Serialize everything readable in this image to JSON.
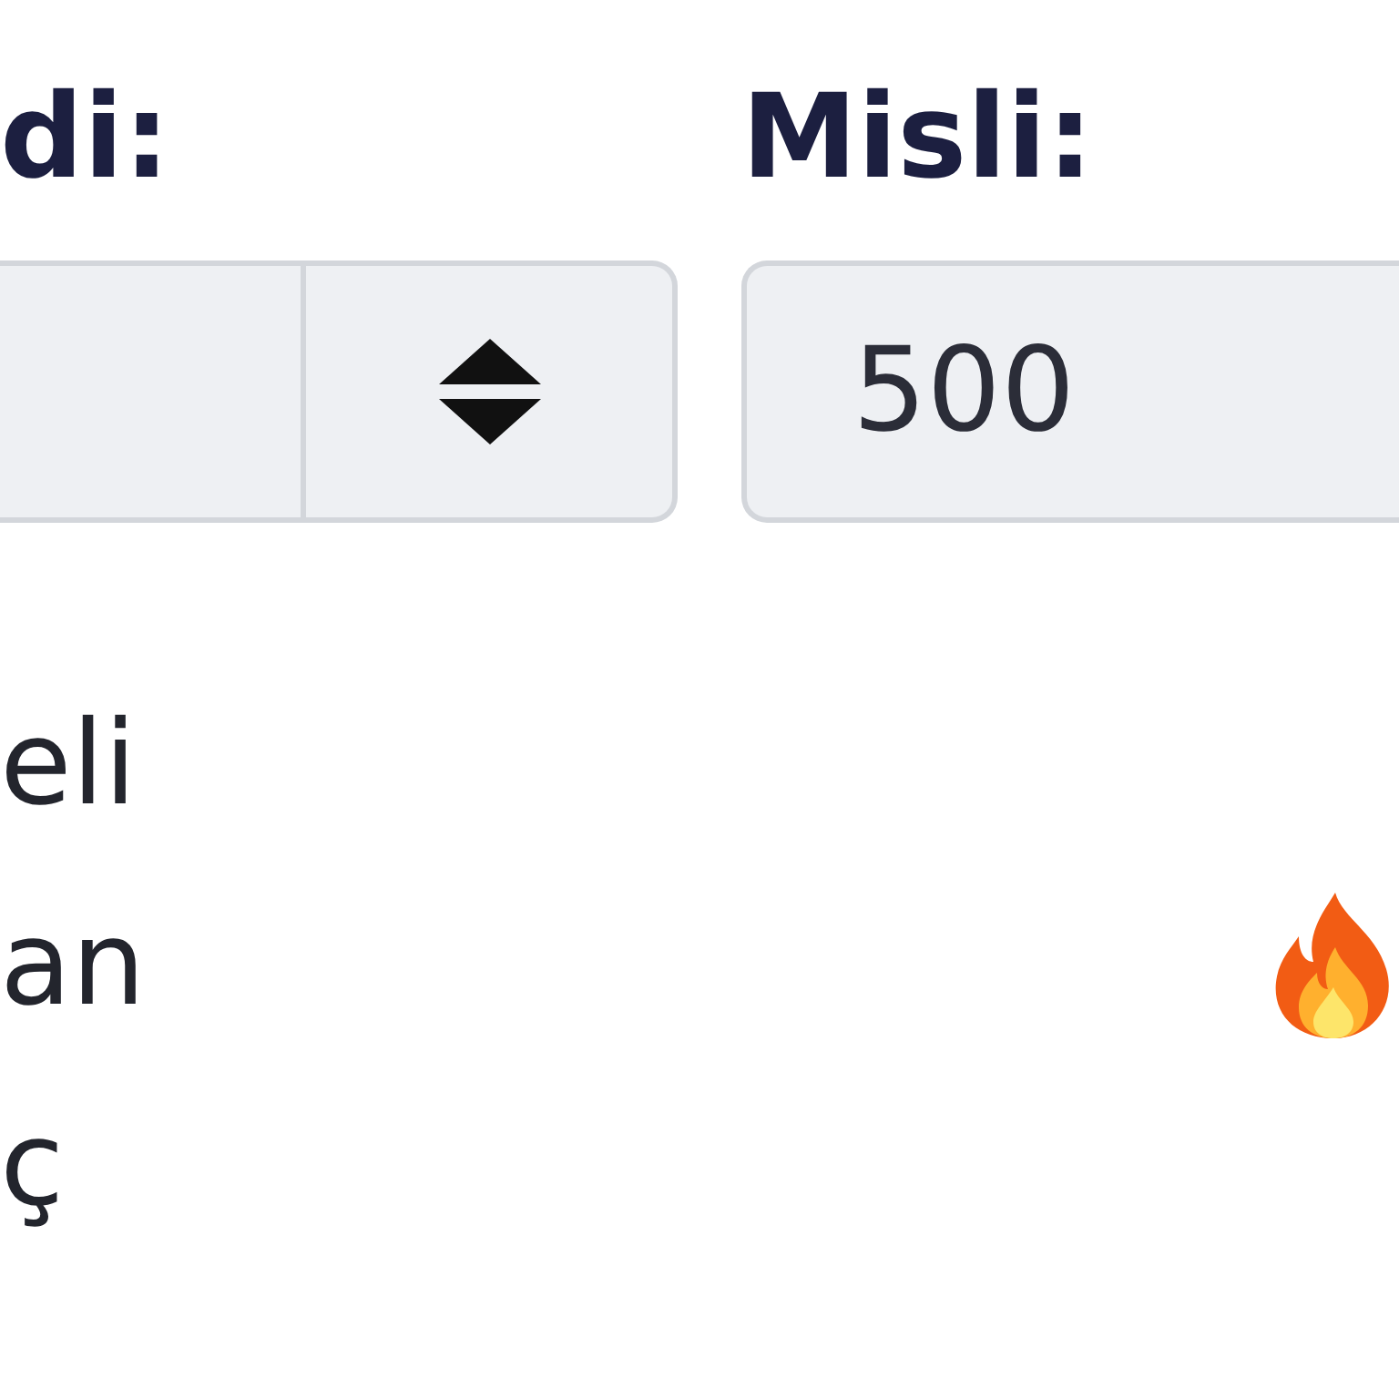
{
  "fields": [
    {
      "kind": "select",
      "label": "di:"
    },
    {
      "kind": "number",
      "label": "Misli:",
      "value": "500"
    }
  ],
  "items": [
    {
      "text": "eli",
      "hot": false
    },
    {
      "text": "an",
      "hot": true
    },
    {
      "text": "ç",
      "hot": false
    }
  ]
}
